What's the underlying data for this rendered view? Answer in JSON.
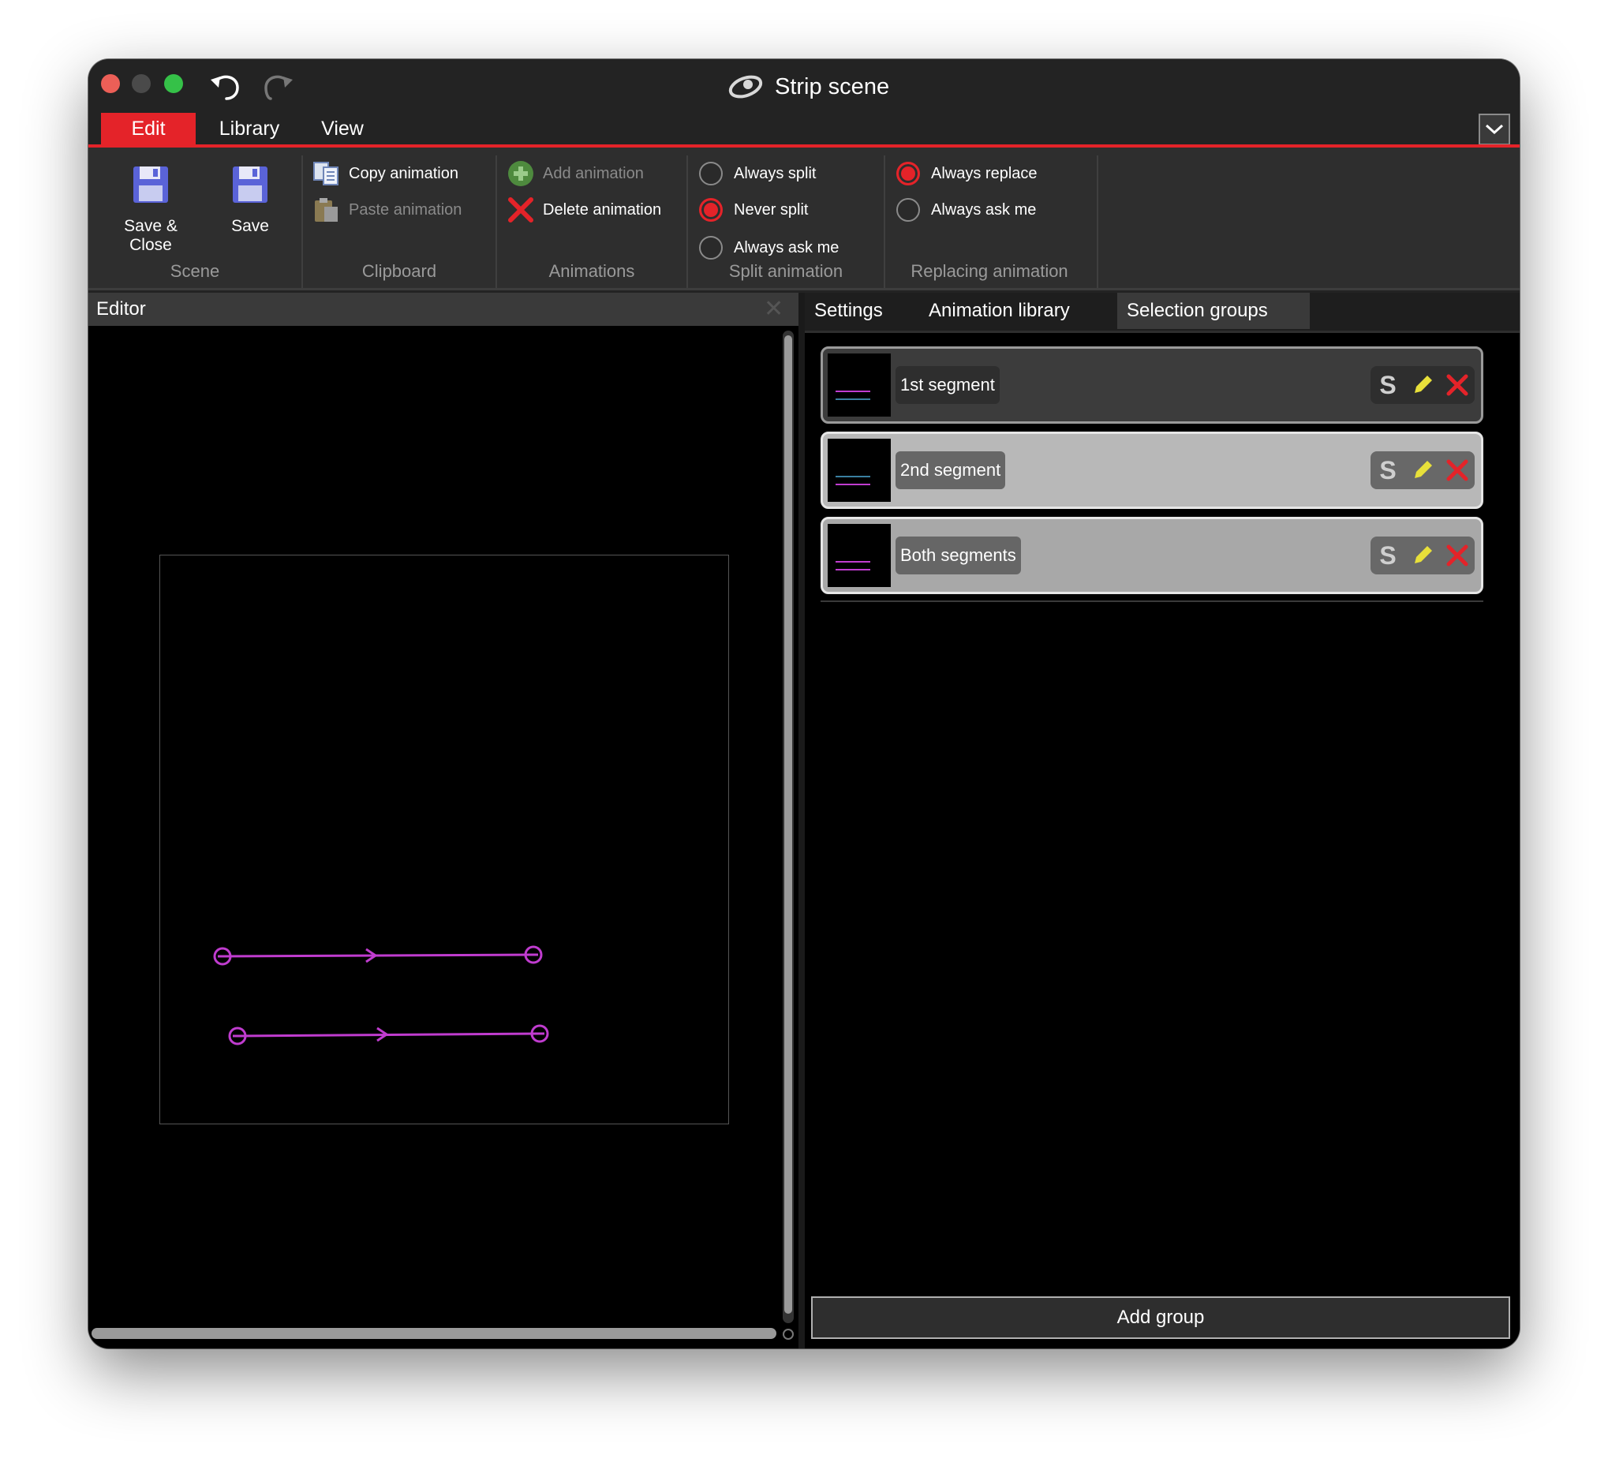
{
  "window": {
    "title": "Strip scene",
    "app_icon": "app-logo-icon"
  },
  "menu": {
    "tabs": [
      "Edit",
      "Library",
      "View"
    ],
    "active_tab": "Edit"
  },
  "ribbon": {
    "scene": {
      "label": "Scene",
      "save_close": "Save & Close",
      "save": "Save"
    },
    "clipboard": {
      "label": "Clipboard",
      "copy": "Copy animation",
      "paste": "Paste animation"
    },
    "animations": {
      "label": "Animations",
      "add": "Add animation",
      "delete": "Delete animation"
    },
    "split": {
      "label": "Split animation",
      "options": [
        "Always split",
        "Never split",
        "Always ask me"
      ],
      "selected": "Never split"
    },
    "replacing": {
      "label": "Replacing animation",
      "options": [
        "Always replace",
        "Always ask me"
      ],
      "selected": "Always replace"
    }
  },
  "editor": {
    "title": "Editor",
    "close_icon": "close-icon"
  },
  "right_panel": {
    "tabs": [
      "Settings",
      "Animation library",
      "Selection groups"
    ],
    "active_tab": "Selection groups",
    "groups": [
      {
        "name": "1st segment",
        "s_label": "S"
      },
      {
        "name": "2nd segment",
        "s_label": "S"
      },
      {
        "name": "Both segments",
        "s_label": "S"
      }
    ],
    "add_group": "Add group"
  },
  "colors": {
    "accent": "#e42329",
    "segment": "#c03ccf",
    "edit_icon": "#e8e03a",
    "delete_icon": "#e42329"
  }
}
